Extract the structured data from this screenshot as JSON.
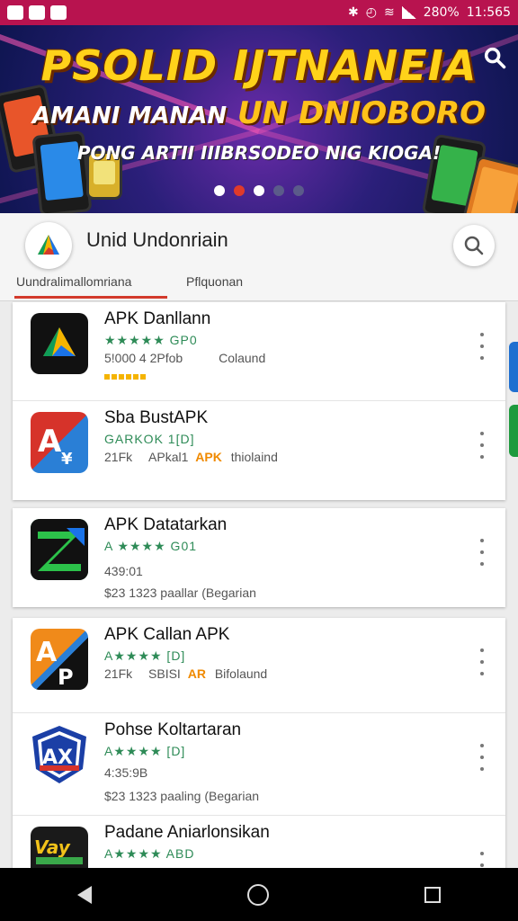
{
  "status_bar": {
    "battery": "280%",
    "time": "11:565"
  },
  "banner": {
    "line1": "PSOLID IJTNANEIA",
    "line2_a": "AMANI MANAN",
    "line2_b": "UN DNIOBORO",
    "line3": "PONG ARTII IIIBRSODEO NIG KIOGA!",
    "carousel_pages": 5,
    "carousel_active": 3
  },
  "app_header": {
    "title": "Unid Undonriain",
    "tabs": [
      "Uundralimallomriana",
      "Pflquonan"
    ]
  },
  "apps": [
    {
      "name": "APK Danllann",
      "rating": "★★★★★ GP0",
      "line3": "5!000 4 2Pfob",
      "line3b": "Colaund",
      "line4": ""
    },
    {
      "name": "Sba BustAPK",
      "rating": "GARKOK 1[D]",
      "line3": "21Fk",
      "line3b": "APkal1",
      "badge": "APK",
      "line3c": "thiolaind",
      "line4": ""
    },
    {
      "name": "APK Datatarkan",
      "rating": "A ★★★★ G01",
      "line3": "439:01",
      "line4": "$23 1323   paallar   (Begarian"
    },
    {
      "name": "APK Callan APK",
      "rating": "A★★★★ [D]",
      "line3": "21Fk",
      "line3b": "SBISI",
      "badge": "AR",
      "line3c": "Bifolaund",
      "line4": ""
    },
    {
      "name": "Pohse Koltartaran",
      "rating": "A★★★★ [D]",
      "line3": "4:35:9B",
      "line4": "$23 1323   paaling   (Begarian"
    },
    {
      "name": "Padane Aniarlonsikan",
      "rating": "A★★★★ ABD",
      "line3": "",
      "line4": ""
    }
  ],
  "colors": {
    "status_bar": "#b8134f",
    "accent": "#d33a2c",
    "rating_green": "#2e8b57"
  }
}
